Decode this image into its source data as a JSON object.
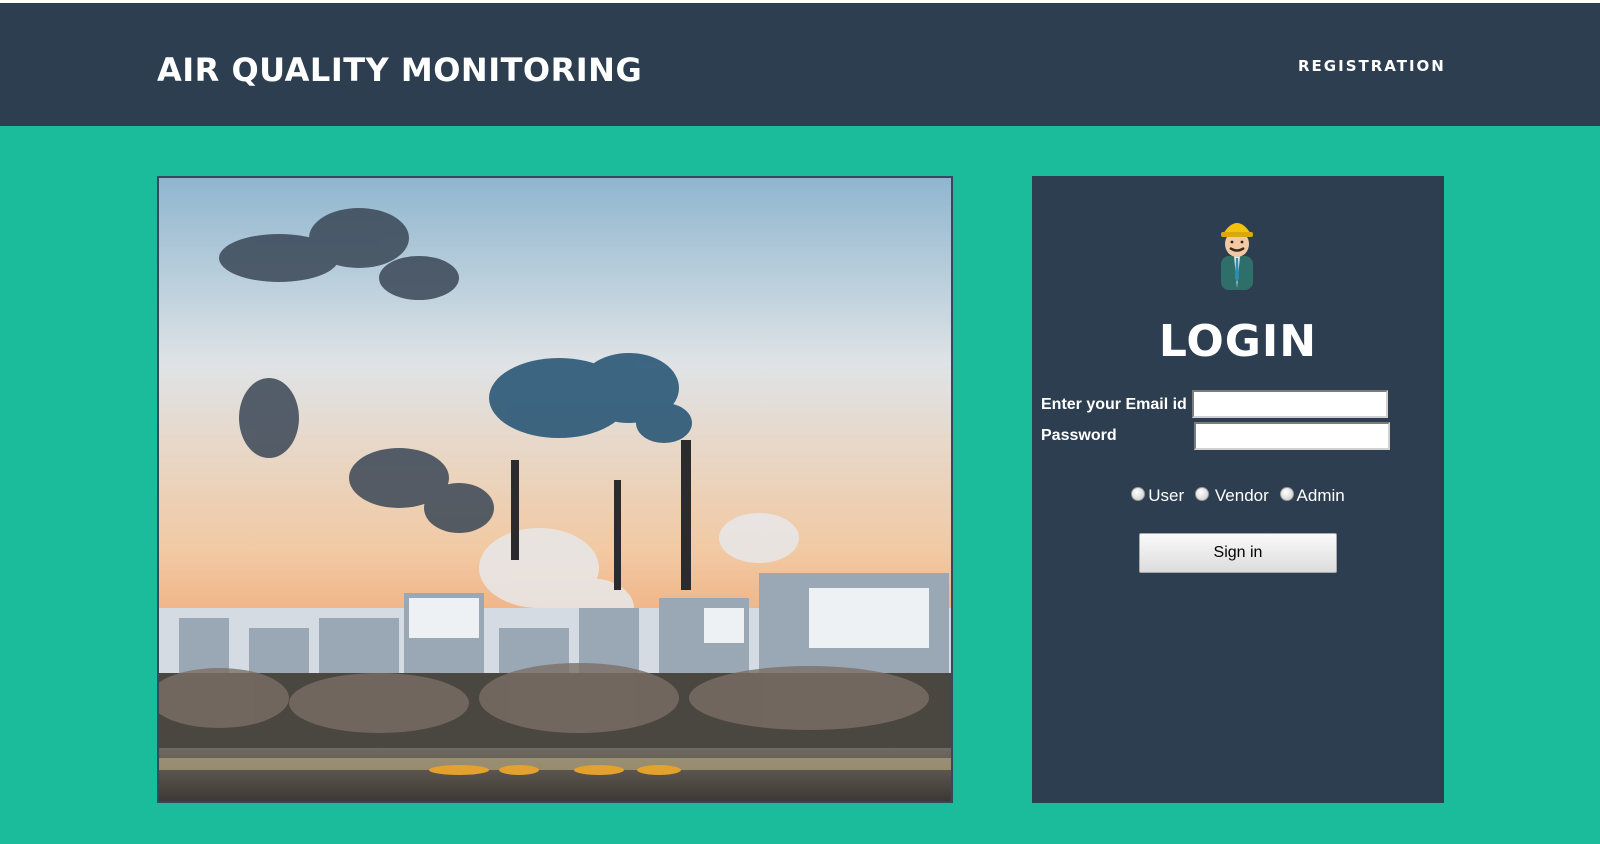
{
  "header": {
    "brand": "AIR QUALITY MONITORING",
    "nav": {
      "registration": "REGISTRATION"
    }
  },
  "hero": {
    "image_icon": "industrial-smokestacks-image"
  },
  "login": {
    "avatar_icon": "worker-avatar-icon",
    "title": "LOGIN",
    "email_label": "Enter your Email id",
    "email_value": "",
    "password_label": "Password",
    "password_value": "",
    "roles": [
      "User",
      "Vendor",
      "Admin"
    ],
    "signin_label": "Sign in"
  },
  "colors": {
    "header_bg": "#2c3e50",
    "main_bg": "#1abc9c",
    "panel_bg": "#2c3e50",
    "text_light": "#ffffff"
  }
}
